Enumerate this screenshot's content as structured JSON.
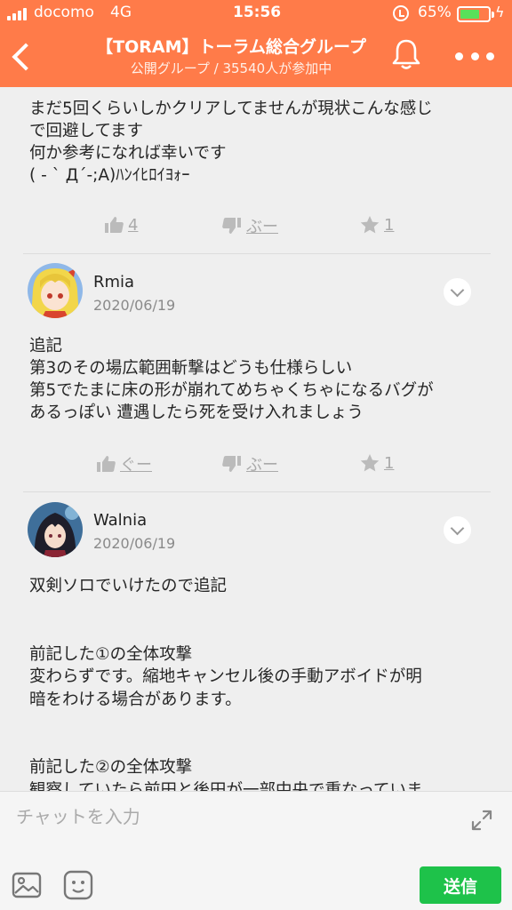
{
  "status_bar": {
    "carrier": "docomo",
    "network": "4G",
    "time": "15:56",
    "battery": "65%"
  },
  "header": {
    "title": "【TORAM】トーラム総合グループ",
    "subtitle": "公開グループ / 35540人が参加中",
    "icons": [
      "back-icon",
      "bell-icon",
      "more-icon"
    ]
  },
  "posts": [
    {
      "text": "まだ5回くらいしかクリアしてませんが現状こんな感じ\nで回避してます\n何か参考になれば幸いです\n( - ` Д´-;A)ﾊﾝｲﾋﾛｲﾖｫｰ",
      "like": "4",
      "dislike": "ぶー",
      "star": "1"
    },
    {
      "user": "Rmia",
      "date": "2020/06/19",
      "text": "追記\n第3のその場広範囲斬撃はどうも仕様らしい\n第5でたまに床の形が崩れてめちゃくちゃになるバグが\nあるっぽい 遭遇したら死を受け入れましょう",
      "like": "ぐー",
      "dislike": "ぶー",
      "star": "1"
    },
    {
      "user": "Walnia",
      "date": "2020/06/19",
      "text": "双剣ソロでいけたので追記\n\n\n前記した①の全体攻撃\n変わらずです。縮地キャンセル後の手動アボイドが明\n暗をわける場合があります。\n\n\n前記した②の全体攻撃\n観察していたら前田と後田が一部中央で重なっていま"
    }
  ],
  "composer": {
    "placeholder": "チャットを入力",
    "send_label": "送信"
  },
  "colors": {
    "header": "#ff7b49",
    "send": "#1ec24a",
    "background": "#efefef"
  }
}
